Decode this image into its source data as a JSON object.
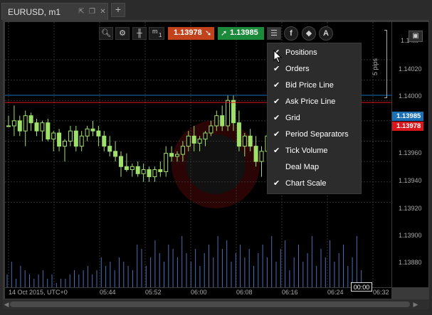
{
  "tab": {
    "title": "EURUSD, m1",
    "new_tab_glyph": "+"
  },
  "toolbar": {
    "timeframe_label": "m",
    "timeframe_sub": "1",
    "sell_price": "1.13978",
    "buy_price": "1.13985",
    "sell_color": "#c2431b",
    "buy_color": "#1c8a3b"
  },
  "price_axis": {
    "labels": [
      "1.14...",
      "1.14020",
      "1.14000",
      "1.13980",
      "1.13960",
      "1.13940",
      "1.13920",
      "1.13900",
      "1.13880"
    ],
    "pips_label": "5 pips",
    "ask_tag": "1.13985",
    "bid_tag": "1.13978",
    "ask_color": "#1a6fb5",
    "bid_color": "#d9161b"
  },
  "time_axis": {
    "labels": [
      "14 Oct 2015, UTC+0",
      "05:44",
      "05:52",
      "06:00",
      "06:08",
      "06:16",
      "06:24",
      "06:32"
    ],
    "cursor_label": "00:00"
  },
  "menu": {
    "items": [
      {
        "label": "Positions",
        "checked": true
      },
      {
        "label": "Orders",
        "checked": true
      },
      {
        "label": "Bid Price Line",
        "checked": true
      },
      {
        "label": "Ask Price Line",
        "checked": true
      },
      {
        "label": "Grid",
        "checked": true
      },
      {
        "label": "Period Separators",
        "checked": true
      },
      {
        "label": "Tick Volume",
        "checked": true
      },
      {
        "label": "Deal Map",
        "checked": false
      },
      {
        "label": "Chart Scale",
        "checked": true
      }
    ],
    "check_glyph": "✔"
  },
  "chart_data": {
    "type": "candlestick",
    "ylim": [
      1.1386,
      1.1405
    ],
    "y_ticks": [
      1.1388,
      1.139,
      1.1392,
      1.1394,
      1.1396,
      1.1398,
      1.14,
      1.1402
    ],
    "bid_line": 1.13978,
    "ask_line": 1.13985,
    "candles": [
      [
        1.13955,
        1.13965,
        1.13955,
        1.13955
      ],
      [
        1.13955,
        1.13975,
        1.13945,
        1.1396
      ],
      [
        1.1396,
        1.13965,
        1.13945,
        1.1395
      ],
      [
        1.1395,
        1.1397,
        1.13935,
        1.13965
      ],
      [
        1.13965,
        1.13968,
        1.1395,
        1.13958
      ],
      [
        1.13958,
        1.13962,
        1.13945,
        1.1395
      ],
      [
        1.1395,
        1.1396,
        1.1394,
        1.13958
      ],
      [
        1.13958,
        1.13962,
        1.1394,
        1.13942
      ],
      [
        1.13942,
        1.1395,
        1.1393,
        1.13948
      ],
      [
        1.13948,
        1.13952,
        1.1393,
        1.13935
      ],
      [
        1.13935,
        1.13942,
        1.1392,
        1.1394
      ],
      [
        1.1394,
        1.13955,
        1.13935,
        1.1395
      ],
      [
        1.1395,
        1.13955,
        1.1393,
        1.13935
      ],
      [
        1.13935,
        1.1395,
        1.1393,
        1.13945
      ],
      [
        1.13945,
        1.13955,
        1.1394,
        1.13952
      ],
      [
        1.13952,
        1.1396,
        1.13945,
        1.1395
      ],
      [
        1.1395,
        1.13955,
        1.13935,
        1.13945
      ],
      [
        1.13945,
        1.1395,
        1.1393,
        1.13935
      ],
      [
        1.13935,
        1.13945,
        1.13925,
        1.1393
      ],
      [
        1.1393,
        1.1394,
        1.1392,
        1.13925
      ],
      [
        1.13925,
        1.1393,
        1.13905,
        1.13915
      ],
      [
        1.13915,
        1.13928,
        1.1391,
        1.13912
      ],
      [
        1.13912,
        1.13918,
        1.13905,
        1.13915
      ],
      [
        1.13915,
        1.1392,
        1.13905,
        1.13908
      ],
      [
        1.13908,
        1.13918,
        1.139,
        1.13912
      ],
      [
        1.13912,
        1.13915,
        1.139,
        1.13905
      ],
      [
        1.13905,
        1.13915,
        1.139,
        1.13912
      ],
      [
        1.13912,
        1.1392,
        1.13905,
        1.1391
      ],
      [
        1.1391,
        1.13935,
        1.13905,
        1.13928
      ],
      [
        1.13928,
        1.13935,
        1.1392,
        1.13925
      ],
      [
        1.13925,
        1.1393,
        1.1392,
        1.13927
      ],
      [
        1.13927,
        1.1394,
        1.1392,
        1.13935
      ],
      [
        1.13935,
        1.1395,
        1.1393,
        1.13945
      ],
      [
        1.13945,
        1.13955,
        1.1393,
        1.13938
      ],
      [
        1.13938,
        1.13945,
        1.1393,
        1.13942
      ],
      [
        1.13942,
        1.1395,
        1.13935,
        1.13948
      ],
      [
        1.13948,
        1.1396,
        1.13945,
        1.13955
      ],
      [
        1.13955,
        1.1397,
        1.1395,
        1.13965
      ],
      [
        1.13965,
        1.13975,
        1.1395,
        1.13955
      ],
      [
        1.13955,
        1.13985,
        1.1395,
        1.1398
      ],
      [
        1.1398,
        1.13985,
        1.1395,
        1.13958
      ],
      [
        1.13958,
        1.1397,
        1.1393,
        1.13935
      ],
      [
        1.13935,
        1.13948,
        1.13925,
        1.13945
      ],
      [
        1.13945,
        1.13952,
        1.1393,
        1.13935
      ],
      [
        1.13935,
        1.13945,
        1.13915,
        1.1392
      ],
      [
        1.1392,
        1.13935,
        1.13905,
        1.1393
      ],
      [
        1.1393,
        1.13948,
        1.1392,
        1.13945
      ],
      [
        1.13945,
        1.13952,
        1.1393,
        1.13935
      ],
      [
        1.13935,
        1.13955,
        1.1393,
        1.1395
      ],
      [
        1.1395,
        1.1397,
        1.13945,
        1.13965
      ],
      [
        1.13965,
        1.1398,
        1.1396,
        1.13975
      ],
      [
        1.13975,
        1.13985,
        1.1396,
        1.13968
      ],
      [
        1.13968,
        1.13978,
        1.1395,
        1.13955
      ],
      [
        1.13955,
        1.1397,
        1.1395,
        1.13965
      ],
      [
        1.13965,
        1.1399,
        1.1396,
        1.13985
      ],
      [
        1.13985,
        1.1399,
        1.13955,
        1.1396
      ],
      [
        1.1396,
        1.13975,
        1.13945,
        1.1397
      ],
      [
        1.1397,
        1.1398,
        1.13955,
        1.13962
      ],
      [
        1.13962,
        1.13975,
        1.13955,
        1.1397
      ],
      [
        1.1397,
        1.13985,
        1.13965,
        1.1398
      ],
      [
        1.1398,
        1.13985,
        1.1397,
        1.13978
      ]
    ],
    "volumes": [
      3,
      6,
      2,
      5,
      4,
      3,
      2,
      3,
      4,
      2,
      3,
      1,
      2,
      2,
      3,
      4,
      3,
      4,
      5,
      3,
      4,
      7,
      5,
      6,
      4,
      7,
      6,
      5,
      4,
      10,
      9,
      5,
      7,
      11,
      8,
      6,
      10,
      9,
      7,
      12,
      8,
      6,
      9,
      5,
      8,
      10,
      7,
      12,
      9,
      11,
      6,
      8,
      10,
      7,
      9,
      5,
      8,
      10,
      7,
      12,
      6,
      9,
      11,
      4,
      7,
      10,
      6,
      8,
      12,
      5,
      9,
      7,
      11,
      6,
      8,
      10,
      5,
      7,
      12,
      4,
      6
    ]
  }
}
